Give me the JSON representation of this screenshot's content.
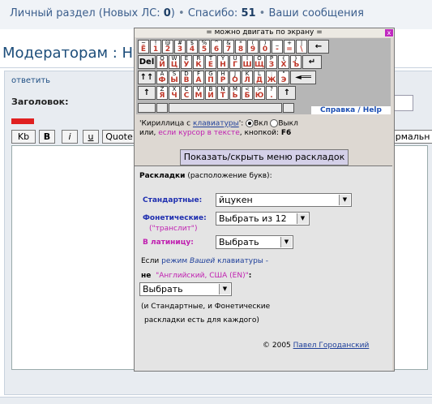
{
  "forum": {
    "personal_section": "Личный раздел (Новых ЛС: ",
    "new_pm_count": "0",
    "personal_close": ")",
    "sep": "•",
    "thanks_label": "Спасибо: ",
    "thanks_count": "51",
    "my_messages": "Ваши сообщения",
    "page_title": "Модераторам : Ну",
    "reply_link": "ответить",
    "subject_label": "Заголовок:",
    "toolbar": {
      "kb": "Kb",
      "b": "B",
      "i": "i",
      "u": "u",
      "quote": "Quote"
    },
    "format_select": "ормальн"
  },
  "keyboard": {
    "header": "= можно двигать по экрану =",
    "close": "x",
    "rows": [
      {
        "keys": [
          {
            "l": "~",
            "c": "Ё"
          },
          {
            "l": "!",
            "c": "1"
          },
          {
            "l": "@",
            "c": "2"
          },
          {
            "l": "#",
            "c": "3"
          },
          {
            "l": "$",
            "c": "4"
          },
          {
            "l": "%",
            "c": "5"
          },
          {
            "l": "^",
            "c": "6"
          },
          {
            "l": "&",
            "c": "7"
          },
          {
            "l": "*",
            "c": "8"
          },
          {
            "l": "(",
            "c": "9"
          },
          {
            "l": ")",
            "c": "0"
          },
          {
            "l": "_",
            "c": "-"
          },
          {
            "l": "+",
            "c": "="
          },
          {
            "l": "|",
            "c": "\\"
          }
        ],
        "fkeys": [
          "←"
        ]
      },
      {
        "fkeys_pre": [
          "Del"
        ],
        "keys": [
          {
            "l": "Q",
            "c": "Й"
          },
          {
            "l": "W",
            "c": "Ц"
          },
          {
            "l": "E",
            "c": "У"
          },
          {
            "l": "R",
            "c": "К"
          },
          {
            "l": "T",
            "c": "Е"
          },
          {
            "l": "Y",
            "c": "Н"
          },
          {
            "l": "U",
            "c": "Г"
          },
          {
            "l": "I",
            "c": "Ш"
          },
          {
            "l": "O",
            "c": "Щ"
          },
          {
            "l": "P",
            "c": "З"
          },
          {
            "l": "{",
            "c": "Х"
          },
          {
            "l": "}",
            "c": "Ъ"
          }
        ],
        "fkeys": [
          "↵"
        ]
      },
      {
        "fkeys_pre": [
          "↑↑"
        ],
        "keys": [
          {
            "l": "A",
            "c": "Ф"
          },
          {
            "l": "S",
            "c": "Ы"
          },
          {
            "l": "D",
            "c": "В"
          },
          {
            "l": "F",
            "c": "А"
          },
          {
            "l": "G",
            "c": "П"
          },
          {
            "l": "H",
            "c": "Р"
          },
          {
            "l": "J",
            "c": "О"
          },
          {
            "l": "K",
            "c": "Л"
          },
          {
            "l": "L",
            "c": "Д"
          },
          {
            "l": ":",
            "c": "Ж"
          },
          {
            "l": "\"",
            "c": "Э"
          }
        ],
        "fkeys": [
          "◄══"
        ]
      },
      {
        "fkeys_pre": [
          "↑"
        ],
        "keys": [
          {
            "l": "Z",
            "c": "Я"
          },
          {
            "l": "X",
            "c": "Ч"
          },
          {
            "l": "C",
            "c": "С"
          },
          {
            "l": "V",
            "c": "М"
          },
          {
            "l": "B",
            "c": "И"
          },
          {
            "l": "N",
            "c": "Т"
          },
          {
            "l": "M",
            "c": "Ь"
          },
          {
            "l": "<",
            "c": "Б"
          },
          {
            "l": ">",
            "c": "Ю"
          },
          {
            "l": "?",
            "c": "."
          }
        ],
        "fkeys": [
          "↑"
        ]
      }
    ],
    "help_link": "Справка / Help",
    "cyr_prefix": "'Кириллица с ",
    "cyr_link": "клавиатуры",
    "cyr_colon": "':",
    "on_label": "Вкл",
    "off_label": "Выкл",
    "hint_prefix": "или, ",
    "hint_mag": "если курсор в тексте",
    "hint_suffix": ", кнопкой:",
    "hint_key": "F6",
    "menu_button": "Показать/скрыть меню раскладок",
    "layouts_title_bold": "Раскладки",
    "layouts_title_rest": " (расположение букв):",
    "standard_label": "Стандартные:",
    "standard_value": "йцукен",
    "phonetic_label": "Фонетические:",
    "phonetic_sub": "(\"транслит\")",
    "phonetic_value": "Выбрать из 12",
    "latin_label": "В латиницу:",
    "latin_value": "Выбрать",
    "if_mode_1": "Если ",
    "if_mode_2": "режим ",
    "if_mode_3": "Вашей",
    "if_mode_4": " клавиатуры -",
    "ne": "не",
    "eng_usa": "\"Английский, США (EN)\"",
    "ne_colon": ":",
    "select_value": "Выбрать",
    "note_1": "(и Стандартные, и Фонетические",
    "note_2": "раскладки есть для каждого)",
    "copyright": "© 2005 ",
    "author": "Павел Городанский"
  },
  "colors": {
    "link": "#3b5e8c",
    "title": "#1c4d7a",
    "key_text": "#c0392b",
    "magenta": "#c01fb0",
    "blue_label": "#1f2fb0"
  }
}
